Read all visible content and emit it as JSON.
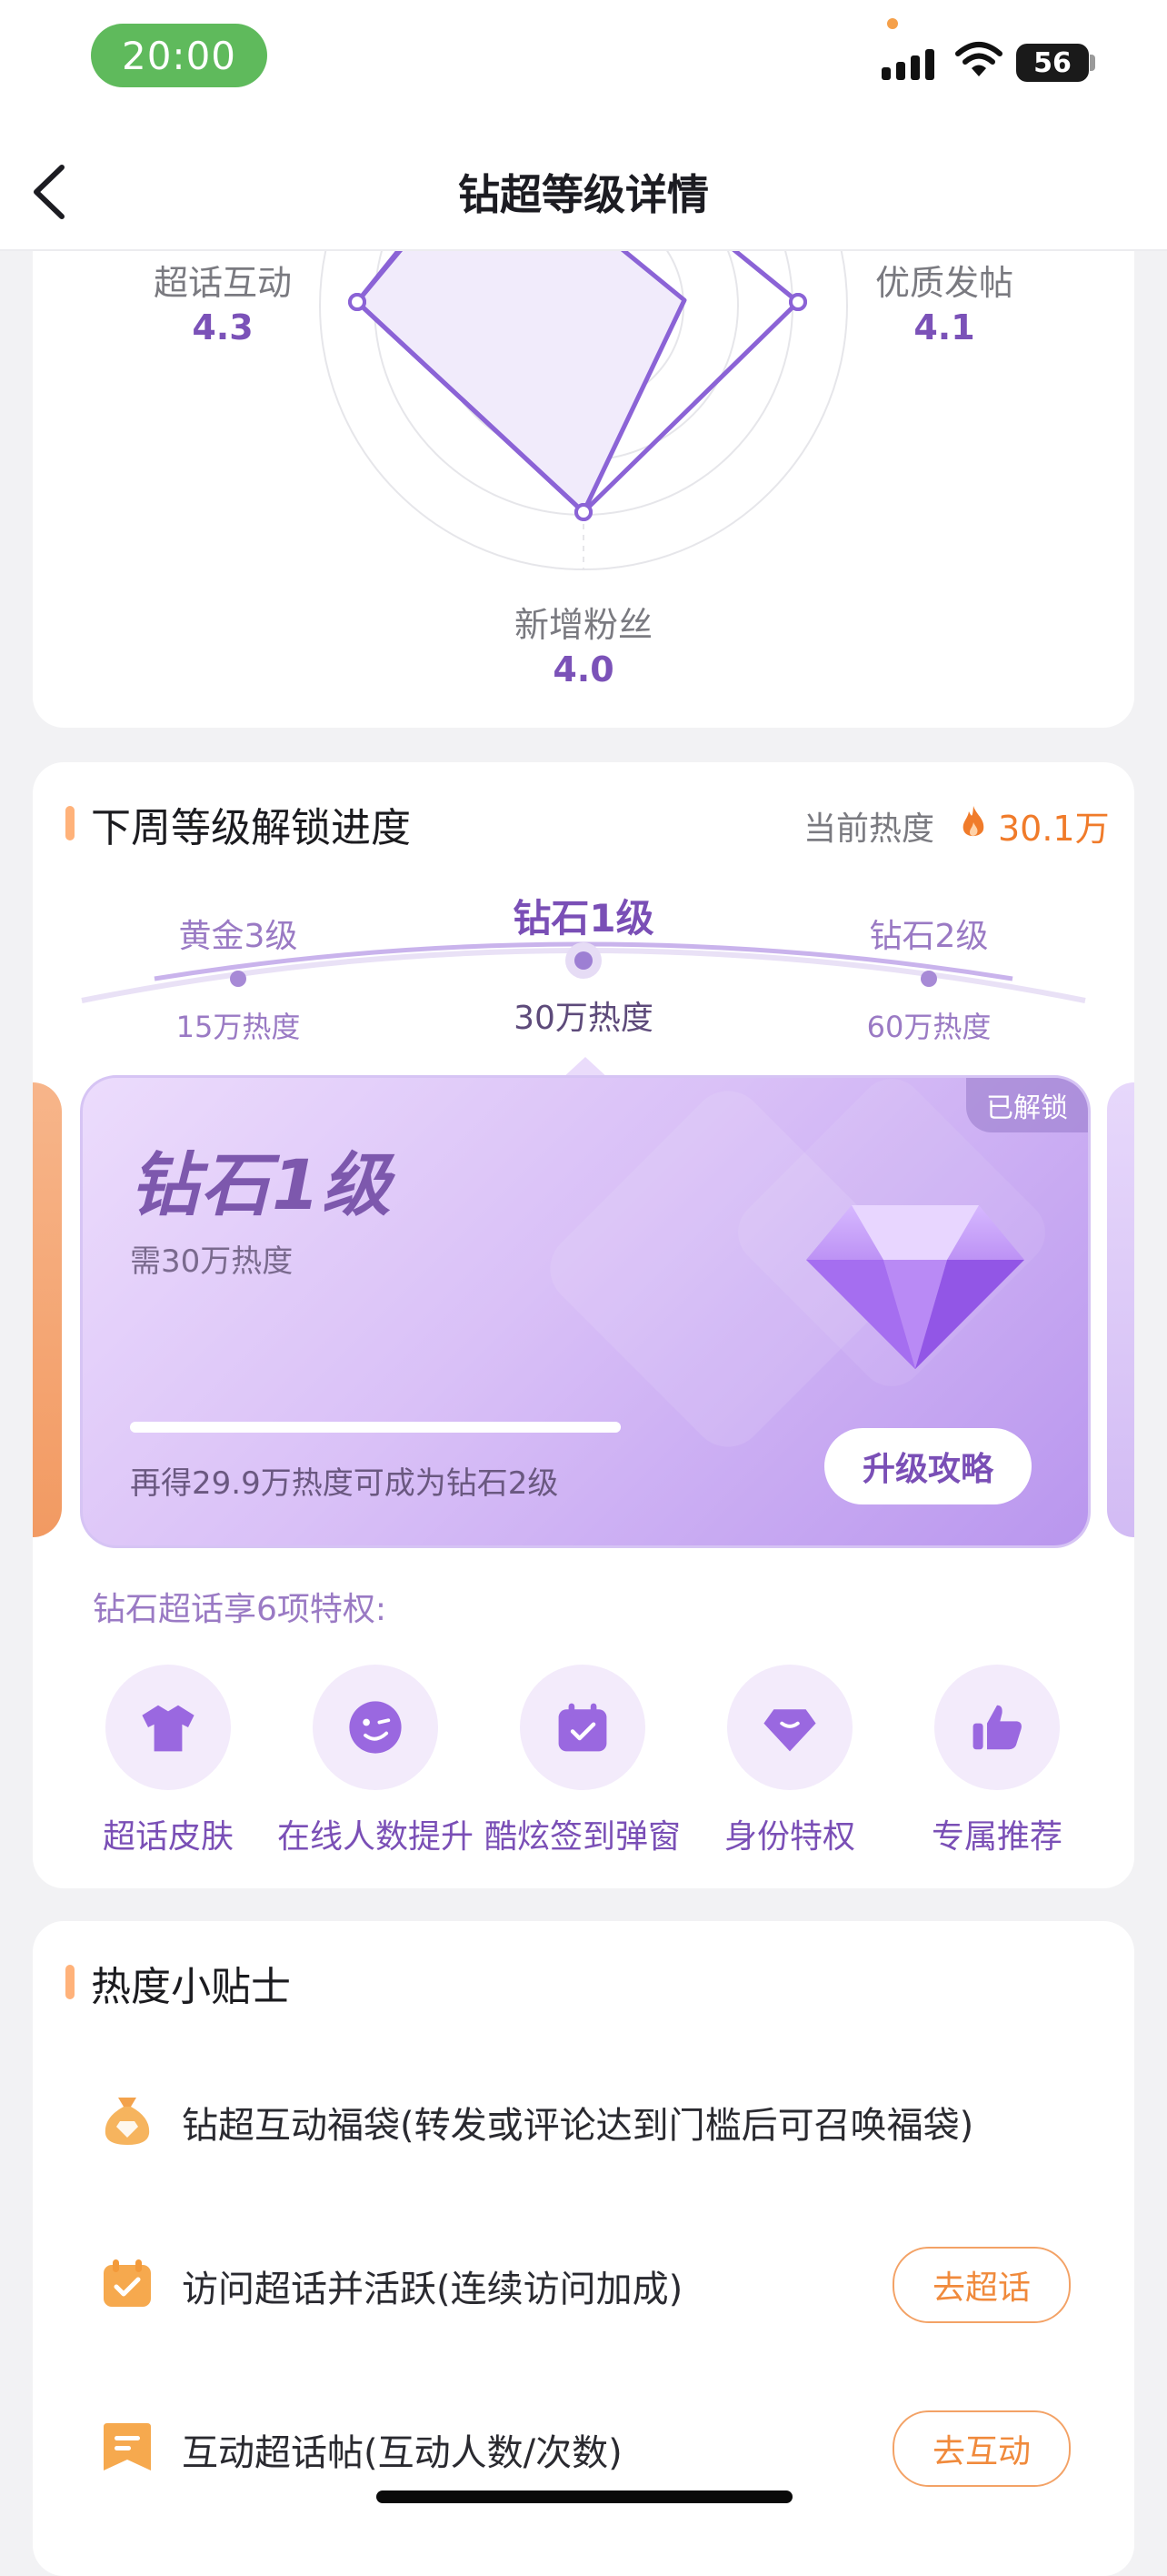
{
  "status": {
    "time": "20:00",
    "battery": "56"
  },
  "nav": {
    "title": "钻超等级详情"
  },
  "radar": {
    "axes": [
      {
        "label": "超话互动",
        "value": "4.3"
      },
      {
        "label": "优质发帖",
        "value": "4.1"
      },
      {
        "label": "新增粉丝",
        "value": "4.0"
      }
    ],
    "colors": {
      "stroke": "#8b63d6",
      "fill": "#f1ebfb"
    }
  },
  "unlock": {
    "title": "下周等级解锁进度",
    "heat_label": "当前热度",
    "heat_value": "30.1万",
    "tiers": [
      {
        "name": "黄金3级",
        "heat": "15万热度"
      },
      {
        "name": "钻石1级",
        "heat": "30万热度"
      },
      {
        "name": "钻石2级",
        "heat": "60万热度"
      }
    ],
    "card": {
      "badge": "已解锁",
      "level": "钻石1级",
      "requirement": "需30万热度",
      "progress": 1.0,
      "hint": "再得29.9万热度可成为钻石2级",
      "button": "升级攻略"
    },
    "perks_title": "钻石超话享6项特权:",
    "perks": [
      {
        "label": "超话皮肤",
        "icon": "tshirt-icon"
      },
      {
        "label": "在线人数提升",
        "icon": "wink-face-icon"
      },
      {
        "label": "酷炫签到弹窗",
        "icon": "calendar-check-icon"
      },
      {
        "label": "身份特权",
        "icon": "diamond-icon"
      },
      {
        "label": "专属推荐",
        "icon": "thumbs-up-icon"
      }
    ]
  },
  "tips": {
    "title": "热度小贴士",
    "items": [
      {
        "text": "钻超互动福袋(转发或评论达到门槛后可召唤福袋)",
        "icon": "lucky-bag-icon"
      },
      {
        "text": "访问超话并活跃(连续访问加成)",
        "icon": "calendar-check-icon",
        "button": "去超话"
      },
      {
        "text": "互动超话帖(互动人数/次数)",
        "icon": "bookmark-icon",
        "button": "去互动"
      }
    ]
  }
}
